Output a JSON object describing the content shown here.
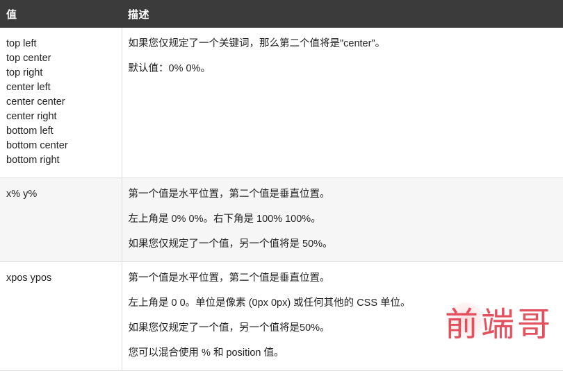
{
  "table": {
    "headers": {
      "value": "值",
      "description": "描述"
    },
    "rows": [
      {
        "value_lines": [
          "top left",
          "top center",
          "top right",
          "center left",
          "center center",
          "center right",
          "bottom left",
          "bottom center",
          "bottom right"
        ],
        "description_paragraphs": [
          "如果您仅规定了一个关键词，那么第二个值将是\"center\"。",
          "默认值：0% 0%。"
        ]
      },
      {
        "value_lines": [
          "x% y%"
        ],
        "description_paragraphs": [
          "第一个值是水平位置，第二个值是垂直位置。",
          "左上角是 0% 0%。右下角是 100% 100%。",
          "如果您仅规定了一个值，另一个值将是 50%。"
        ]
      },
      {
        "value_lines": [
          "xpos ypos"
        ],
        "description_paragraphs": [
          "第一个值是水平位置，第二个值是垂直位置。",
          "左上角是 0 0。单位是像素 (0px 0px) 或任何其他的 CSS 单位。",
          "如果您仅规定了一个值，另一个值将是50%。",
          "您可以混合使用 % 和 position 值。"
        ]
      }
    ]
  },
  "watermark": {
    "text": "前端哥",
    "color": "#e03a4a"
  },
  "colors": {
    "header_background": "#3b3b3b",
    "header_text": "#ffffff",
    "row_alt_background": "#f6f6f6",
    "row_background": "#ffffff",
    "border": "#dddddd",
    "body_text": "#222222"
  }
}
